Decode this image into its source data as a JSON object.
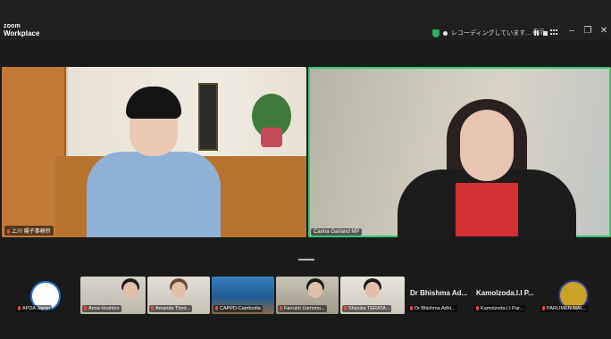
{
  "app": {
    "brand_top": "zoom",
    "brand_bottom": "Workplace"
  },
  "recording": {
    "status_text": "レコーディングしています...",
    "view_label": "表示"
  },
  "icons": {
    "shield": "shield-icon",
    "pause": "pause-icon",
    "stop": "stop-icon",
    "grid": "grid-icon"
  },
  "window_controls": {
    "minimize": "–",
    "restore": "❐",
    "close": "✕"
  },
  "main_videos": [
    {
      "name": "上川 陽子事務所"
    },
    {
      "name": "Carina Garland MP"
    }
  ],
  "thumbnails": [
    {
      "name": "APDA Japan"
    },
    {
      "name": "Anna Hoshino"
    },
    {
      "name": "Amanda Third..."
    },
    {
      "name": "CAPPD-Cambodia"
    },
    {
      "name": "Farrukh Usmono..."
    },
    {
      "name": "Shizuka TERATA..."
    },
    {
      "display_name": "Dr Bhishma Ad...",
      "name": "Dr Bhishma Adhi..."
    },
    {
      "display_name": "Kamolzoda.I.I P...",
      "name": "Kamolzoda.I.I Par..."
    },
    {
      "name": "PARLIMEN MAL..."
    }
  ],
  "colors": {
    "active_speaker": "#2ecc71",
    "muted_mic": "#e74c3c"
  }
}
